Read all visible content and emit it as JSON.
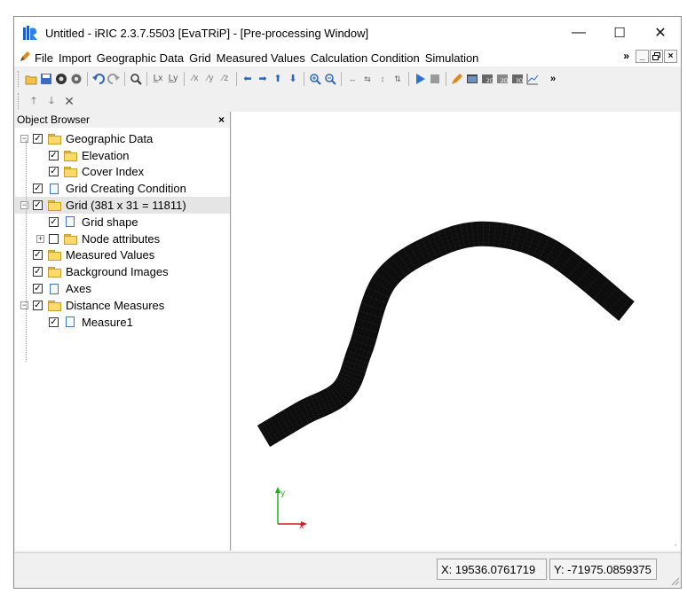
{
  "window": {
    "title": "Untitled - iRIC 2.3.7.5503 [EvaTRiP] - [Pre-processing Window]",
    "minimize": "—",
    "maximize": "☐",
    "close": "✕"
  },
  "menubar": {
    "items": [
      "File",
      "Import",
      "Geographic Data",
      "Grid",
      "Measured Values",
      "Calculation Condition",
      "Simulation"
    ],
    "overflow": "»",
    "mdi": [
      "_",
      "🗗",
      "×"
    ]
  },
  "toolbar": {
    "overflow": "»",
    "icons": [
      "open-folder-icon",
      "save-icon",
      "snapshot-icon",
      "settings-icon",
      "undo-icon",
      "redo-icon",
      "zoom-fit-icon",
      "axis-x-icon",
      "axis-y-icon",
      "scale-x-icon",
      "scale-y-icon",
      "scale-z-icon",
      "arrow-left-icon",
      "arrow-right-icon",
      "arrow-up-icon",
      "arrow-down-icon",
      "zoom-in-icon",
      "zoom-out-icon",
      "expand-horizontal-icon",
      "expand-vertical-icon",
      "run-icon",
      "stop-icon",
      "pencil-icon",
      "graph-window-icon",
      "2d-view-icon",
      "2d-bird-view-icon",
      "3d-view-icon",
      "chart-icon"
    ]
  },
  "toolbar2": {
    "icons": [
      "move-up-icon",
      "move-down-icon",
      "delete-icon"
    ]
  },
  "object_browser": {
    "title": "Object Browser",
    "close": "×",
    "items": [
      {
        "label": "Geographic Data",
        "level": 0,
        "expander": "−",
        "checked": true,
        "icon": "folder"
      },
      {
        "label": "Elevation",
        "level": 1,
        "checked": true,
        "icon": "folder"
      },
      {
        "label": "Cover Index",
        "level": 1,
        "checked": true,
        "icon": "folder"
      },
      {
        "label": "Grid Creating Condition",
        "level": 0,
        "checked": true,
        "icon": "doc"
      },
      {
        "label": "Grid (381 x 31 = 11811)",
        "level": 0,
        "expander": "−",
        "checked": true,
        "icon": "folder-green",
        "selected": true
      },
      {
        "label": "Grid shape",
        "level": 1,
        "checked": true,
        "icon": "doc"
      },
      {
        "label": "Node attributes",
        "level": 1,
        "expander": "+",
        "checked": false,
        "icon": "folder"
      },
      {
        "label": "Measured Values",
        "level": 0,
        "checked": true,
        "icon": "folder"
      },
      {
        "label": "Background Images",
        "level": 0,
        "checked": true,
        "icon": "folder"
      },
      {
        "label": "Axes",
        "level": 0,
        "checked": true,
        "icon": "doc"
      },
      {
        "label": "Distance Measures",
        "level": 0,
        "expander": "−",
        "checked": true,
        "icon": "folder"
      },
      {
        "label": "Measure1",
        "level": 1,
        "checked": true,
        "icon": "doc"
      }
    ]
  },
  "axes": {
    "x_label": "x",
    "y_label": "y",
    "x_color": "#d81b1b",
    "y_color": "#1db01d"
  },
  "status": {
    "x": "X: 19536.0761719",
    "y": "Y: -71975.0859375"
  },
  "colors": {
    "grid": "#111111",
    "accent": "#2f6fd6"
  }
}
